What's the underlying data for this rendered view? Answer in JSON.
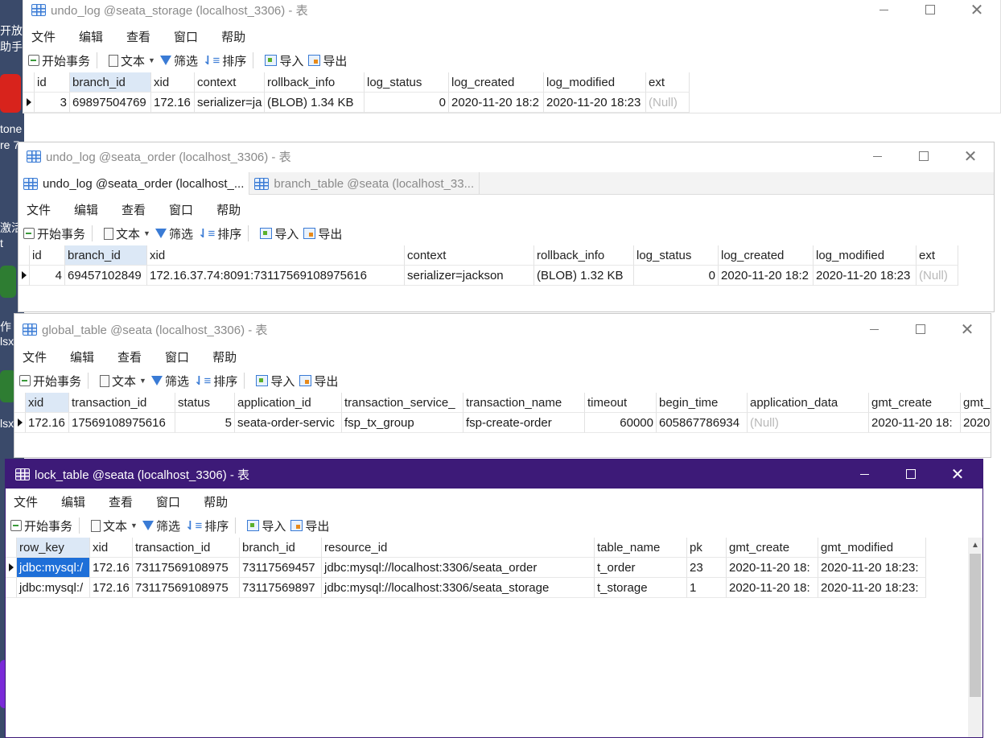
{
  "desktop": {
    "fragments": [
      "开放",
      "助手",
      "tone",
      "re 7",
      "激活",
      "t",
      "作",
      "lsx",
      "lsx",
      "·"
    ]
  },
  "menu": [
    "文件",
    "编辑",
    "查看",
    "窗口",
    "帮助"
  ],
  "toolbar": {
    "begin_tx": "开始事务",
    "text": "文本",
    "filter": "筛选",
    "sort": "排序",
    "import": "导入",
    "export": "导出"
  },
  "windows": {
    "storage": {
      "title": "undo_log @seata_storage (localhost_3306) - 表",
      "columns": [
        "id",
        "branch_id",
        "xid",
        "context",
        "rollback_info",
        "log_status",
        "log_created",
        "log_modified",
        "ext"
      ],
      "row": [
        "3",
        "69897504769",
        "172.16",
        "serializer=ja",
        "(BLOB) 1.34 KB",
        "0",
        "2020-11-20 18:2",
        "2020-11-20 18:23",
        "(Null)"
      ]
    },
    "order": {
      "title": "undo_log @seata_order (localhost_3306) - 表",
      "tabs": [
        "undo_log @seata_order (localhost_...",
        "branch_table @seata (localhost_33..."
      ],
      "columns": [
        "id",
        "branch_id",
        "xid",
        "context",
        "rollback_info",
        "log_status",
        "log_created",
        "log_modified",
        "ext"
      ],
      "row": [
        "4",
        "69457102849",
        "172.16.37.74:8091:73117569108975616",
        "serializer=jackson",
        "(BLOB) 1.32 KB",
        "0",
        "2020-11-20 18:2",
        "2020-11-20 18:23",
        "(Null)"
      ]
    },
    "global": {
      "title": "global_table @seata (localhost_3306) - 表",
      "columns": [
        "xid",
        "transaction_id",
        "status",
        "application_id",
        "transaction_service_",
        "transaction_name",
        "timeout",
        "begin_time",
        "application_data",
        "gmt_create",
        "gmt_"
      ],
      "row": [
        "172.16",
        "17569108975616",
        "5",
        "seata-order-servic",
        "fsp_tx_group",
        "fsp-create-order",
        "60000",
        "605867786934",
        "(Null)",
        "2020-11-20 18:",
        "2020"
      ]
    },
    "lock": {
      "title": "lock_table @seata (localhost_3306) - 表",
      "columns": [
        "row_key",
        "xid",
        "transaction_id",
        "branch_id",
        "resource_id",
        "table_name",
        "pk",
        "gmt_create",
        "gmt_modified"
      ],
      "rows": [
        [
          "jdbc:mysql:/",
          "172.16",
          "73117569108975",
          "73117569457",
          "jdbc:mysql://localhost:3306/seata_order",
          "t_order",
          "23",
          "2020-11-20 18:",
          "2020-11-20 18:23:"
        ],
        [
          "jdbc:mysql:/",
          "172.16",
          "73117569108975",
          "73117569897",
          "jdbc:mysql://localhost:3306/seata_storage",
          "t_storage",
          "1",
          "2020-11-20 18:",
          "2020-11-20 18:23:"
        ]
      ]
    }
  },
  "colors": {
    "active_titlebar": "#3d1a78",
    "selection": "#1e6fd8",
    "null_text": "#b8b8b8"
  }
}
